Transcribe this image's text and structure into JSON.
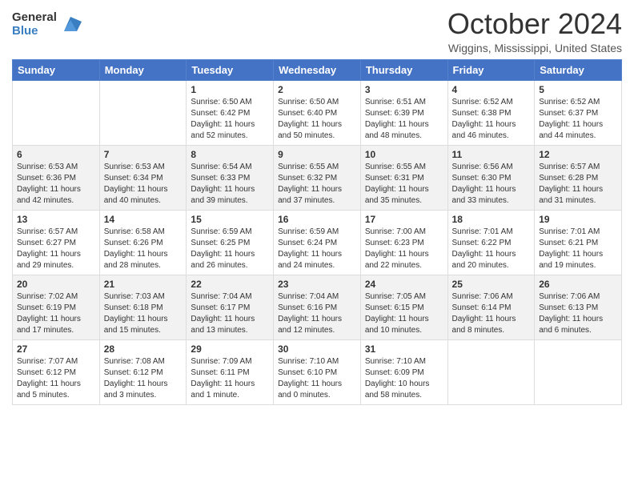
{
  "header": {
    "logo_general": "General",
    "logo_blue": "Blue",
    "title": "October 2024",
    "location": "Wiggins, Mississippi, United States"
  },
  "weekdays": [
    "Sunday",
    "Monday",
    "Tuesday",
    "Wednesday",
    "Thursday",
    "Friday",
    "Saturday"
  ],
  "weeks": [
    [
      {
        "day": "",
        "info": ""
      },
      {
        "day": "",
        "info": ""
      },
      {
        "day": "1",
        "info": "Sunrise: 6:50 AM\nSunset: 6:42 PM\nDaylight: 11 hours and 52 minutes."
      },
      {
        "day": "2",
        "info": "Sunrise: 6:50 AM\nSunset: 6:40 PM\nDaylight: 11 hours and 50 minutes."
      },
      {
        "day": "3",
        "info": "Sunrise: 6:51 AM\nSunset: 6:39 PM\nDaylight: 11 hours and 48 minutes."
      },
      {
        "day": "4",
        "info": "Sunrise: 6:52 AM\nSunset: 6:38 PM\nDaylight: 11 hours and 46 minutes."
      },
      {
        "day": "5",
        "info": "Sunrise: 6:52 AM\nSunset: 6:37 PM\nDaylight: 11 hours and 44 minutes."
      }
    ],
    [
      {
        "day": "6",
        "info": "Sunrise: 6:53 AM\nSunset: 6:36 PM\nDaylight: 11 hours and 42 minutes."
      },
      {
        "day": "7",
        "info": "Sunrise: 6:53 AM\nSunset: 6:34 PM\nDaylight: 11 hours and 40 minutes."
      },
      {
        "day": "8",
        "info": "Sunrise: 6:54 AM\nSunset: 6:33 PM\nDaylight: 11 hours and 39 minutes."
      },
      {
        "day": "9",
        "info": "Sunrise: 6:55 AM\nSunset: 6:32 PM\nDaylight: 11 hours and 37 minutes."
      },
      {
        "day": "10",
        "info": "Sunrise: 6:55 AM\nSunset: 6:31 PM\nDaylight: 11 hours and 35 minutes."
      },
      {
        "day": "11",
        "info": "Sunrise: 6:56 AM\nSunset: 6:30 PM\nDaylight: 11 hours and 33 minutes."
      },
      {
        "day": "12",
        "info": "Sunrise: 6:57 AM\nSunset: 6:28 PM\nDaylight: 11 hours and 31 minutes."
      }
    ],
    [
      {
        "day": "13",
        "info": "Sunrise: 6:57 AM\nSunset: 6:27 PM\nDaylight: 11 hours and 29 minutes."
      },
      {
        "day": "14",
        "info": "Sunrise: 6:58 AM\nSunset: 6:26 PM\nDaylight: 11 hours and 28 minutes."
      },
      {
        "day": "15",
        "info": "Sunrise: 6:59 AM\nSunset: 6:25 PM\nDaylight: 11 hours and 26 minutes."
      },
      {
        "day": "16",
        "info": "Sunrise: 6:59 AM\nSunset: 6:24 PM\nDaylight: 11 hours and 24 minutes."
      },
      {
        "day": "17",
        "info": "Sunrise: 7:00 AM\nSunset: 6:23 PM\nDaylight: 11 hours and 22 minutes."
      },
      {
        "day": "18",
        "info": "Sunrise: 7:01 AM\nSunset: 6:22 PM\nDaylight: 11 hours and 20 minutes."
      },
      {
        "day": "19",
        "info": "Sunrise: 7:01 AM\nSunset: 6:21 PM\nDaylight: 11 hours and 19 minutes."
      }
    ],
    [
      {
        "day": "20",
        "info": "Sunrise: 7:02 AM\nSunset: 6:19 PM\nDaylight: 11 hours and 17 minutes."
      },
      {
        "day": "21",
        "info": "Sunrise: 7:03 AM\nSunset: 6:18 PM\nDaylight: 11 hours and 15 minutes."
      },
      {
        "day": "22",
        "info": "Sunrise: 7:04 AM\nSunset: 6:17 PM\nDaylight: 11 hours and 13 minutes."
      },
      {
        "day": "23",
        "info": "Sunrise: 7:04 AM\nSunset: 6:16 PM\nDaylight: 11 hours and 12 minutes."
      },
      {
        "day": "24",
        "info": "Sunrise: 7:05 AM\nSunset: 6:15 PM\nDaylight: 11 hours and 10 minutes."
      },
      {
        "day": "25",
        "info": "Sunrise: 7:06 AM\nSunset: 6:14 PM\nDaylight: 11 hours and 8 minutes."
      },
      {
        "day": "26",
        "info": "Sunrise: 7:06 AM\nSunset: 6:13 PM\nDaylight: 11 hours and 6 minutes."
      }
    ],
    [
      {
        "day": "27",
        "info": "Sunrise: 7:07 AM\nSunset: 6:12 PM\nDaylight: 11 hours and 5 minutes."
      },
      {
        "day": "28",
        "info": "Sunrise: 7:08 AM\nSunset: 6:12 PM\nDaylight: 11 hours and 3 minutes."
      },
      {
        "day": "29",
        "info": "Sunrise: 7:09 AM\nSunset: 6:11 PM\nDaylight: 11 hours and 1 minute."
      },
      {
        "day": "30",
        "info": "Sunrise: 7:10 AM\nSunset: 6:10 PM\nDaylight: 11 hours and 0 minutes."
      },
      {
        "day": "31",
        "info": "Sunrise: 7:10 AM\nSunset: 6:09 PM\nDaylight: 10 hours and 58 minutes."
      },
      {
        "day": "",
        "info": ""
      },
      {
        "day": "",
        "info": ""
      }
    ]
  ]
}
